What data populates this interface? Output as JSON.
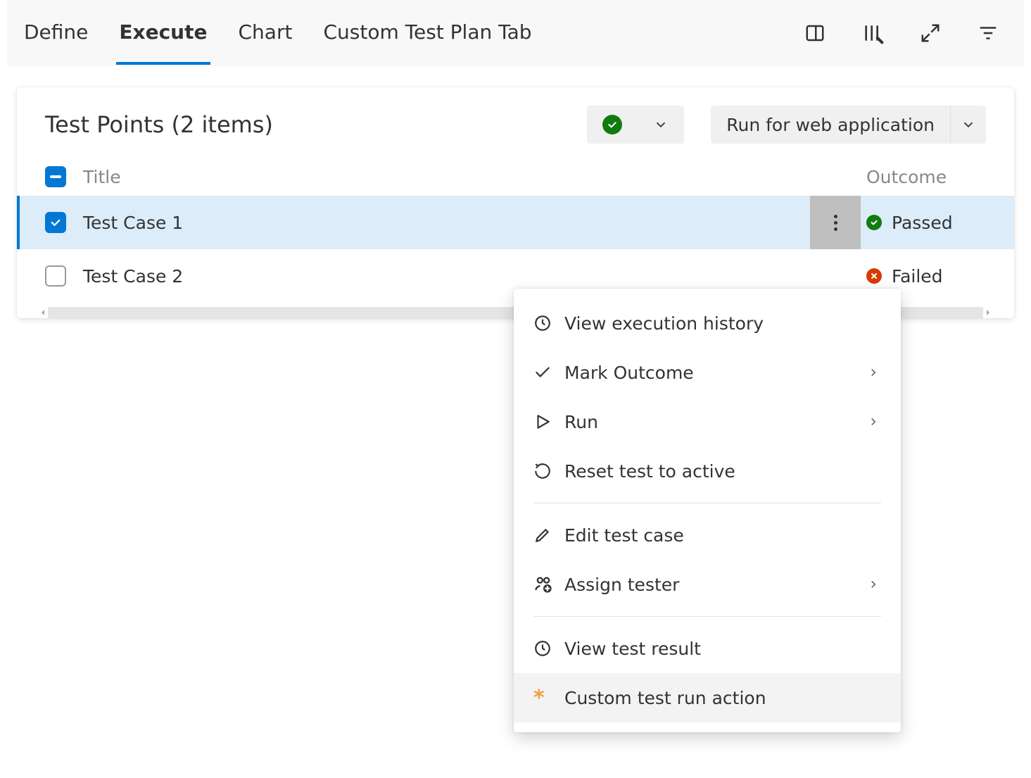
{
  "tabs": {
    "items": [
      {
        "label": "Define"
      },
      {
        "label": "Execute"
      },
      {
        "label": "Chart"
      },
      {
        "label": "Custom Test Plan Tab"
      }
    ],
    "activeIndex": 1
  },
  "panel": {
    "title": "Test Points (2 items)",
    "runButton": "Run for web application"
  },
  "columns": {
    "title": "Title",
    "outcome": "Outcome"
  },
  "rows": [
    {
      "title": "Test Case 1",
      "outcome": "Passed",
      "outcomeType": "pass",
      "checked": true,
      "selected": true,
      "showMore": true
    },
    {
      "title": "Test Case 2",
      "outcome": "Failed",
      "outcomeType": "fail",
      "checked": false,
      "selected": false,
      "showMore": false
    }
  ],
  "menu": {
    "groups": [
      [
        {
          "label": "View execution history",
          "icon": "history",
          "sub": false
        },
        {
          "label": "Mark Outcome",
          "icon": "check",
          "sub": true
        },
        {
          "label": "Run",
          "icon": "play",
          "sub": true
        },
        {
          "label": "Reset test to active",
          "icon": "refresh",
          "sub": false
        }
      ],
      [
        {
          "label": "Edit test case",
          "icon": "edit",
          "sub": false
        },
        {
          "label": "Assign tester",
          "icon": "assign",
          "sub": true
        }
      ],
      [
        {
          "label": "View test result",
          "icon": "history",
          "sub": false
        },
        {
          "label": "Custom test run action",
          "icon": "star",
          "sub": false,
          "hovered": true
        }
      ]
    ]
  }
}
